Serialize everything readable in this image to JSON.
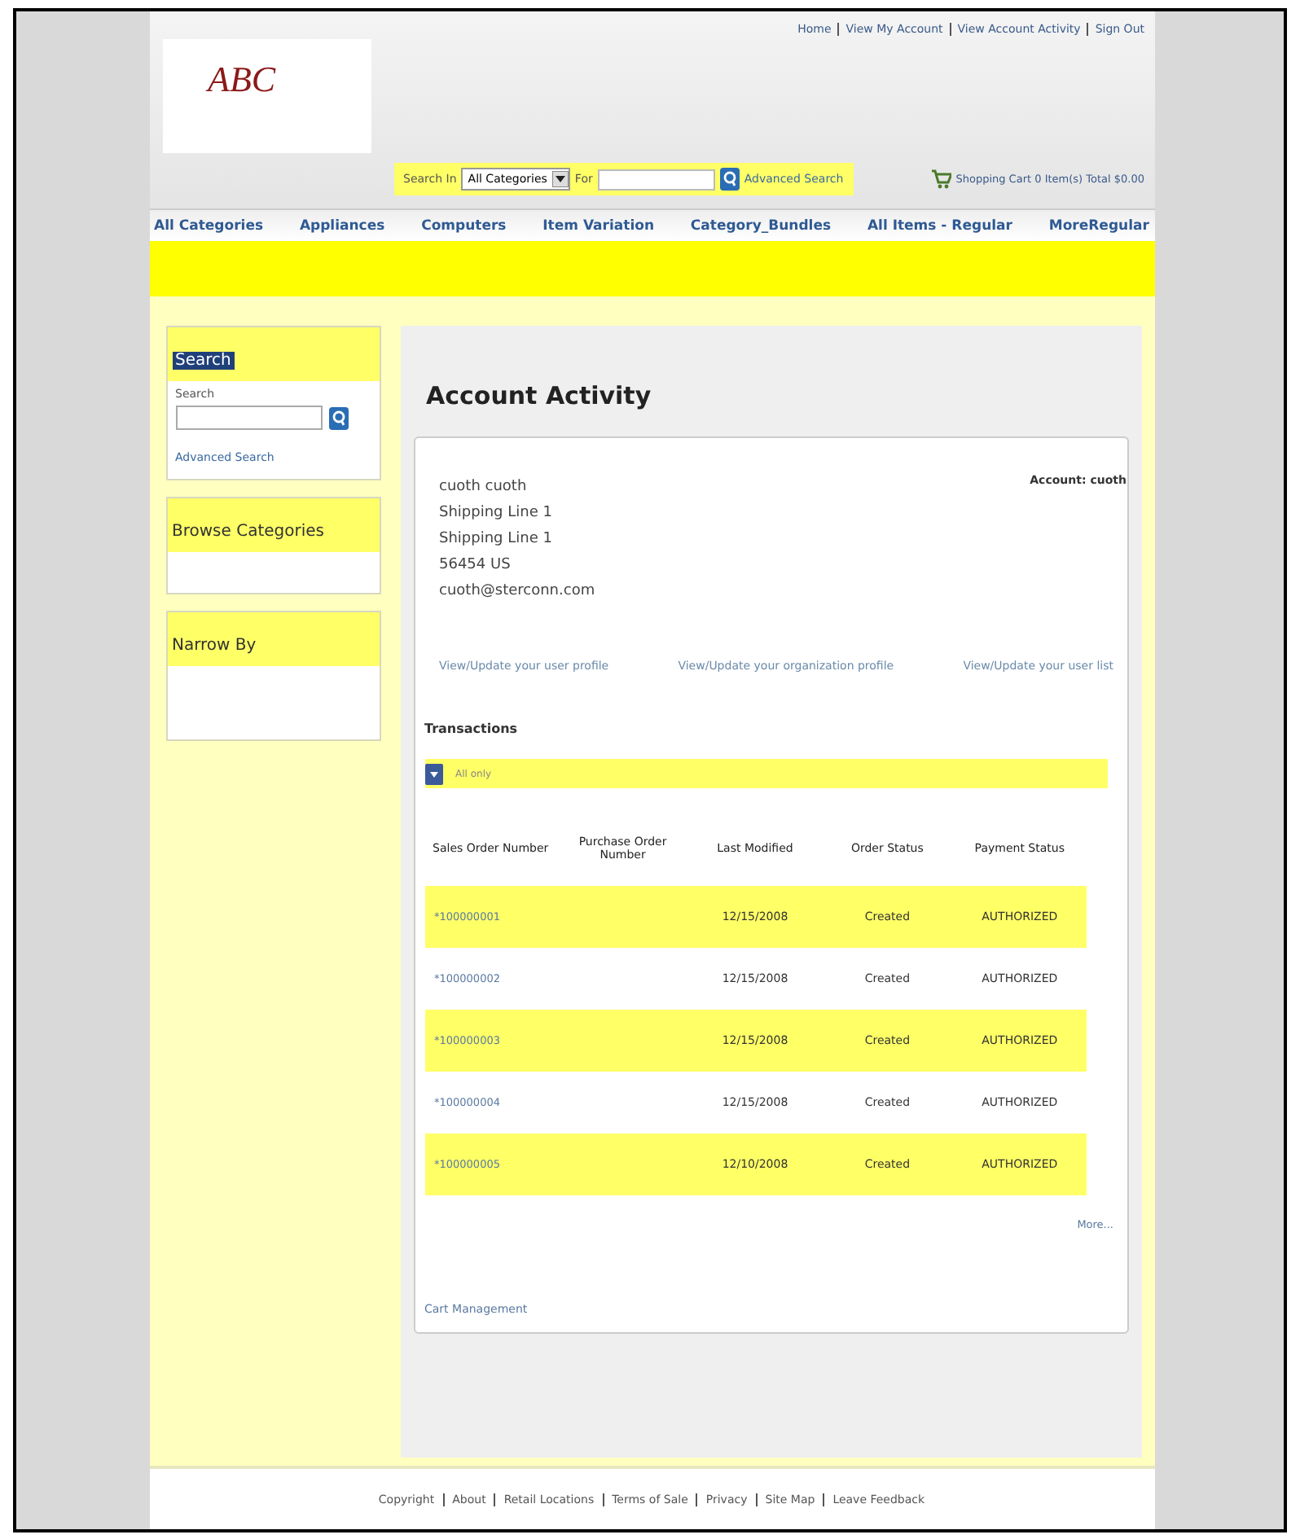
{
  "header": {
    "logo": "ABC",
    "top_links": [
      "Home",
      "View My Account",
      "View Account Activity",
      "Sign Out"
    ],
    "search": {
      "label": "Search In",
      "category": "All Categories",
      "for_label": "For",
      "advanced": "Advanced Search"
    },
    "cart": "Shopping Cart 0 Item(s) Total $0.00"
  },
  "nav": [
    "All Categories",
    "Appliances",
    "Computers",
    "Item Variation",
    "Category_Bundles",
    "All Items - Regular",
    "MoreRegular"
  ],
  "sidebar": [
    {
      "kind": "search",
      "title": "Search",
      "highlighted": true,
      "label": "Search",
      "link": "Advanced Search"
    },
    {
      "kind": "plain",
      "title": "Browse Categories",
      "highlighted": false
    },
    {
      "kind": "plain",
      "title": "Narrow By",
      "highlighted": false
    }
  ],
  "main": {
    "title": "Account Activity",
    "address": [
      "cuoth cuoth",
      "Shipping Line 1",
      "Shipping Line 1",
      "56454 US",
      "cuoth@sterconn.com"
    ],
    "account": "Account: cuoth",
    "links": [
      "View/Update your user profile",
      "View/Update your organization profile",
      "View/Update your user list"
    ],
    "transactions": "Transactions",
    "filter": "All only",
    "columns": [
      "Sales Order Number",
      "Purchase Order Number",
      "Last Modified",
      "Order Status",
      "Payment Status"
    ],
    "rows": [
      [
        "*100000001",
        "",
        "12/15/2008",
        "Created",
        "AUTHORIZED"
      ],
      [
        "*100000002",
        "",
        "12/15/2008",
        "Created",
        "AUTHORIZED"
      ],
      [
        "*100000003",
        "",
        "12/15/2008",
        "Created",
        "AUTHORIZED"
      ],
      [
        "*100000004",
        "",
        "12/15/2008",
        "Created",
        "AUTHORIZED"
      ],
      [
        "*100000005",
        "",
        "12/10/2008",
        "Created",
        "AUTHORIZED"
      ]
    ],
    "more": "More...",
    "cart_link": "Cart Management"
  },
  "footer": [
    "Copyright",
    "About",
    "Retail Locations",
    "Terms of Sale",
    "Privacy",
    "Site Map",
    "Leave Feedback"
  ]
}
